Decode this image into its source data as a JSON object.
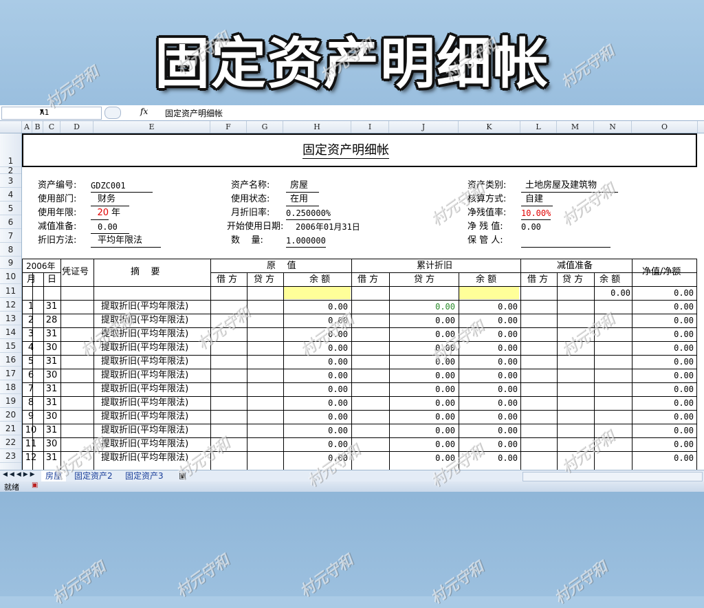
{
  "banner_title": "固定资产明细帐",
  "formula_bar": {
    "name_box": "A1",
    "fx": "fx",
    "content": "固定资产明细帐"
  },
  "columns": [
    "A",
    "B",
    "C",
    "D",
    "E",
    "F",
    "G",
    "H",
    "I",
    "J",
    "K",
    "L",
    "M",
    "N",
    "O"
  ],
  "rows": [
    "1",
    "2",
    "3",
    "4",
    "5",
    "6",
    "7",
    "8",
    "9",
    "10",
    "11",
    "12",
    "13",
    "14",
    "15",
    "16",
    "17",
    "18",
    "19",
    "20",
    "21",
    "22",
    "23"
  ],
  "sheet_title": "固定资产明细帐",
  "info": {
    "asset_no_label": "资产编号:",
    "asset_no": "GDZC001",
    "asset_name_label": "资产名称:",
    "asset_name": "房屋",
    "asset_cat_label": "资产类别:",
    "asset_cat": "土地房屋及建筑物",
    "dept_label": "使用部门:",
    "dept": "财务",
    "status_label": "使用状态:",
    "status": "在用",
    "calc_label": "核算方式:",
    "calc": "自建",
    "years_label": "使用年限:",
    "years": "20",
    "years_unit": "年",
    "rate_label": "月折旧率:",
    "rate": "0.250000%",
    "residual_label": "净残值率:",
    "residual": "10.00%",
    "impair_label": "减值准备:",
    "impair": "0.00",
    "start_label": "开始使用日期:",
    "start": "2006年01月31日",
    "net_residual_label": "净 残 值:",
    "net_residual": "0.00",
    "method_label": "折旧方法:",
    "method": "平均年限法",
    "qty_label": "数    量:",
    "qty": "1.000000",
    "keeper_label": "保 管 人:"
  },
  "table_header": {
    "year": "2006年",
    "month": "月",
    "day": "日",
    "voucher": "凭证号",
    "summary": "摘    要",
    "orig": "原    值",
    "accum": "累计折旧",
    "impair": "减值准备",
    "net": "净值/净额",
    "debit": "借 方",
    "credit": "贷 方",
    "balance": "余 额",
    "balance2": "余  额"
  },
  "row11": {
    "n": "0.00",
    "o": "0.00"
  },
  "entries": [
    {
      "m": "1",
      "d": "31",
      "s": "提取折旧(平均年限法)",
      "h": "0.00",
      "j": "0.00",
      "k": "0.00",
      "o": "0.00"
    },
    {
      "m": "2",
      "d": "28",
      "s": "提取折旧(平均年限法)",
      "h": "0.00",
      "j": "0.00",
      "k": "0.00",
      "o": "0.00"
    },
    {
      "m": "3",
      "d": "31",
      "s": "提取折旧(平均年限法)",
      "h": "0.00",
      "j": "0.00",
      "k": "0.00",
      "o": "0.00"
    },
    {
      "m": "4",
      "d": "30",
      "s": "提取折旧(平均年限法)",
      "h": "0.00",
      "j": "0.00",
      "k": "0.00",
      "o": "0.00"
    },
    {
      "m": "5",
      "d": "31",
      "s": "提取折旧(平均年限法)",
      "h": "0.00",
      "j": "0.00",
      "k": "0.00",
      "o": "0.00"
    },
    {
      "m": "6",
      "d": "30",
      "s": "提取折旧(平均年限法)",
      "h": "0.00",
      "j": "0.00",
      "k": "0.00",
      "o": "0.00"
    },
    {
      "m": "7",
      "d": "31",
      "s": "提取折旧(平均年限法)",
      "h": "0.00",
      "j": "0.00",
      "k": "0.00",
      "o": "0.00"
    },
    {
      "m": "8",
      "d": "31",
      "s": "提取折旧(平均年限法)",
      "h": "0.00",
      "j": "0.00",
      "k": "0.00",
      "o": "0.00"
    },
    {
      "m": "9",
      "d": "30",
      "s": "提取折旧(平均年限法)",
      "h": "0.00",
      "j": "0.00",
      "k": "0.00",
      "o": "0.00"
    },
    {
      "m": "10",
      "d": "31",
      "s": "提取折旧(平均年限法)",
      "h": "0.00",
      "j": "0.00",
      "k": "0.00",
      "o": "0.00"
    },
    {
      "m": "11",
      "d": "30",
      "s": "提取折旧(平均年限法)",
      "h": "0.00",
      "j": "0.00",
      "k": "0.00",
      "o": "0.00"
    },
    {
      "m": "12",
      "d": "31",
      "s": "提取折旧(平均年限法)",
      "h": "0.00",
      "j": "0.00",
      "k": "0.00",
      "o": "0.00"
    }
  ],
  "tabs": [
    "房屋",
    "固定资产2",
    "固定资产3"
  ],
  "status_text": "就绪",
  "watermark": "村元守和"
}
